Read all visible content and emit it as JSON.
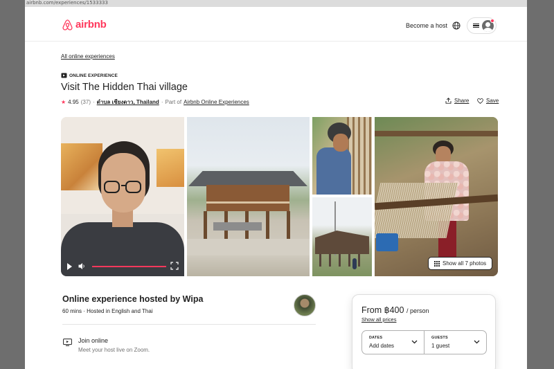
{
  "browser": {
    "strip_text": "airbnb.com/experiences/1533333"
  },
  "header": {
    "logo_text": "airbnb",
    "become_host": "Become a host",
    "brand_color": "#FF385C",
    "icons": [
      "airbnb-logo-icon",
      "globe-icon",
      "menu-icon",
      "user-avatar-icon"
    ]
  },
  "breadcrumb": {
    "all_experiences": "All online experiences"
  },
  "listing": {
    "badge": "ONLINE EXPERIENCE",
    "title": "Visit The Hidden Thai village",
    "rating": "4.95",
    "reviews": "(37)",
    "location": "ตำบล เชียงดาว, Thailand",
    "part_of_prefix": "Part of",
    "part_of_link": "Airbnb Online Experiences",
    "separator": "·",
    "share": "Share",
    "save": "Save"
  },
  "gallery": {
    "show_all": "Show all 7 photos",
    "video_progress": 0.9
  },
  "host": {
    "title": "Online experience hosted by Wipa",
    "subtitle": "60 mins · Hosted in English and Thai",
    "join_title": "Join online",
    "join_sub": "Meet your host live on Zoom."
  },
  "booking": {
    "price": "From ฿400",
    "per": "/ person",
    "show_prices": "Show all prices",
    "dates_label": "DATES",
    "dates_value": "Add dates",
    "guests_label": "GUESTS",
    "guests_value": "1 guest"
  }
}
